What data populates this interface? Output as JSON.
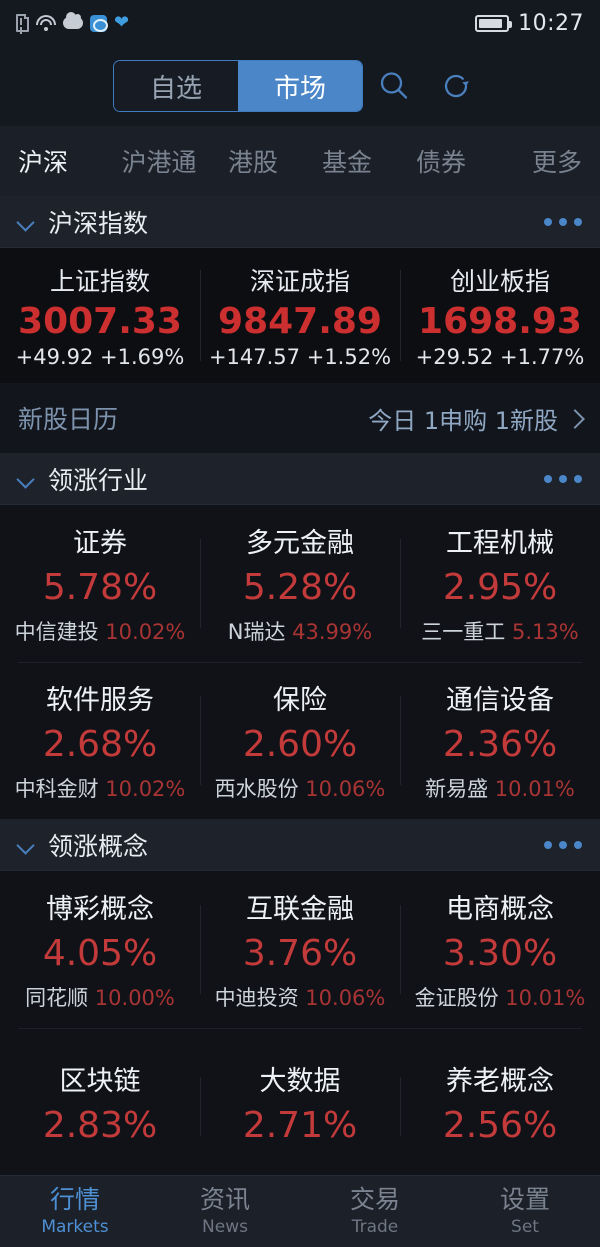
{
  "statusbar": {
    "time": "10:27",
    "icons": [
      "sim-alert-icon",
      "wifi-icon",
      "cloud-icon",
      "app-icon",
      "heart-icon"
    ],
    "battery": "battery-icon"
  },
  "topbar": {
    "segments": [
      {
        "label": "自选",
        "active": false
      },
      {
        "label": "市场",
        "active": true
      }
    ],
    "search_icon": "search-icon",
    "refresh_icon": "refresh-icon"
  },
  "category_tabs": [
    {
      "label": "沪深",
      "active": true
    },
    {
      "label": "沪港通",
      "active": false
    },
    {
      "label": "港股",
      "active": false
    },
    {
      "label": "基金",
      "active": false
    },
    {
      "label": "债券",
      "active": false
    },
    {
      "label": "更多",
      "active": false
    }
  ],
  "index_section": {
    "title": "沪深指数",
    "more_label": "more-dots",
    "indices": [
      {
        "name": "上证指数",
        "value": "3007.33",
        "change": "+49.92",
        "percent": "+1.69%"
      },
      {
        "name": "深证成指",
        "value": "9847.89",
        "change": "+147.57",
        "percent": "+1.52%"
      },
      {
        "name": "创业板指",
        "value": "1698.93",
        "change": "+29.52",
        "percent": "+1.77%"
      }
    ]
  },
  "new_stock_bar": {
    "label": "新股日历",
    "info": "今日 1申购 1新股"
  },
  "industry_section": {
    "title": "领涨行业",
    "rows": [
      [
        {
          "name": "证券",
          "percent": "5.78%",
          "stock": "中信建投",
          "stock_percent": "10.02%"
        },
        {
          "name": "多元金融",
          "percent": "5.28%",
          "stock": "N瑞达",
          "stock_percent": "43.99%"
        },
        {
          "name": "工程机械",
          "percent": "2.95%",
          "stock": "三一重工",
          "stock_percent": "5.13%"
        }
      ],
      [
        {
          "name": "软件服务",
          "percent": "2.68%",
          "stock": "中科金财",
          "stock_percent": "10.02%"
        },
        {
          "name": "保险",
          "percent": "2.60%",
          "stock": "西水股份",
          "stock_percent": "10.06%"
        },
        {
          "name": "通信设备",
          "percent": "2.36%",
          "stock": "新易盛",
          "stock_percent": "10.01%"
        }
      ]
    ]
  },
  "concept_section": {
    "title": "领涨概念",
    "rows": [
      [
        {
          "name": "博彩概念",
          "percent": "4.05%",
          "stock": "同花顺",
          "stock_percent": "10.00%"
        },
        {
          "name": "互联金融",
          "percent": "3.76%",
          "stock": "中迪投资",
          "stock_percent": "10.06%"
        },
        {
          "name": "电商概念",
          "percent": "3.30%",
          "stock": "金证股份",
          "stock_percent": "10.01%"
        }
      ],
      [
        {
          "name": "区块链",
          "percent": "2.83%",
          "stock": "",
          "stock_percent": ""
        },
        {
          "name": "大数据",
          "percent": "2.71%",
          "stock": "",
          "stock_percent": ""
        },
        {
          "name": "养老概念",
          "percent": "2.56%",
          "stock": "",
          "stock_percent": ""
        }
      ]
    ]
  },
  "bottom_nav": [
    {
      "cn": "行情",
      "en": "Markets",
      "active": true
    },
    {
      "cn": "资讯",
      "en": "News",
      "active": false
    },
    {
      "cn": "交易",
      "en": "Trade",
      "active": false
    },
    {
      "cn": "设置",
      "en": "Set",
      "active": false
    }
  ],
  "colors": {
    "accent": "#4a86c8",
    "up_red": "#c33a3a",
    "background": "#14181f"
  }
}
